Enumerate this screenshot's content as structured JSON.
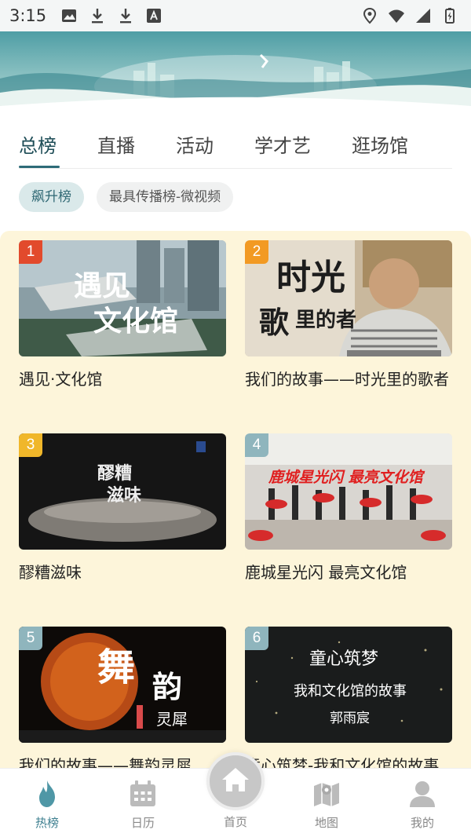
{
  "status_bar": {
    "time": "3:15",
    "left_icons": [
      "image-icon",
      "download-icon",
      "download-icon",
      "font-icon"
    ],
    "right_icons": [
      "location-icon",
      "wifi-icon",
      "signal-icon",
      "battery-icon"
    ]
  },
  "tabs": [
    {
      "label": "总榜",
      "active": true
    },
    {
      "label": "直播",
      "active": false
    },
    {
      "label": "活动",
      "active": false
    },
    {
      "label": "学才艺",
      "active": false
    },
    {
      "label": "逛场馆",
      "active": false
    }
  ],
  "chips": [
    {
      "label": "飙升榜",
      "active": true
    },
    {
      "label": "最具传播榜-微视频",
      "active": false
    }
  ],
  "cards": [
    {
      "rank": "1",
      "title": "遇见·文化馆",
      "overlay": "遇见 文化馆"
    },
    {
      "rank": "2",
      "title": "我们的故事——时光里的歌者",
      "overlay": "时光里的歌者"
    },
    {
      "rank": "3",
      "title": "醪糟滋味",
      "overlay": "醪糟 滋味"
    },
    {
      "rank": "4",
      "title": "鹿城星光闪 最亮文化馆",
      "overlay": "鹿城星光闪 最亮文化馆"
    },
    {
      "rank": "5",
      "title": "我们的故事——舞韵灵犀",
      "overlay": "舞韵灵犀"
    },
    {
      "rank": "6",
      "title": "童心筑梦-我和文化馆的故事",
      "overlay": "童心筑梦 我和文化馆的故事 郭雨宸"
    }
  ],
  "bottom_nav": [
    {
      "label": "热榜",
      "icon": "flame-icon",
      "active": true
    },
    {
      "label": "日历",
      "icon": "calendar-icon",
      "active": false
    },
    {
      "label": "首页",
      "icon": "home-icon",
      "active": false
    },
    {
      "label": "地图",
      "icon": "map-icon",
      "active": false
    },
    {
      "label": "我的",
      "icon": "user-icon",
      "active": false
    }
  ],
  "colors": {
    "accent": "#2d6b78",
    "chip_active_bg": "#dae9ea",
    "content_bg": "#fdf5da",
    "rank_1": "#e24a2c",
    "rank_2": "#f29a23",
    "rank_3": "#f0b72a",
    "rank_other": "#8fb5bd"
  }
}
